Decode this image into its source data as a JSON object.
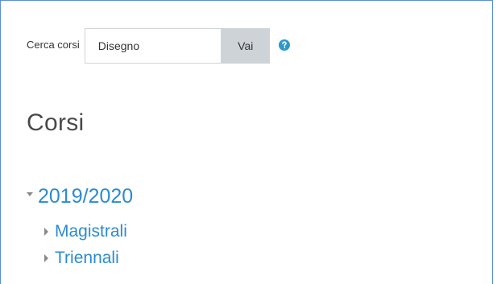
{
  "search": {
    "label": "Cerca corsi",
    "value": "Disegno",
    "button_label": "Vai",
    "help_icon": "question-circle-icon"
  },
  "page": {
    "title": "Corsi"
  },
  "tree": {
    "root": {
      "label": "2019/2020",
      "expanded": true
    },
    "children": [
      {
        "label": "Magistrali",
        "expanded": false
      },
      {
        "label": "Triennali",
        "expanded": false
      }
    ]
  },
  "colors": {
    "link": "#2c8bcf",
    "help_icon": "#2f97c9",
    "button_bg": "#ced3d8",
    "frame_border": "#5b8fd6"
  }
}
